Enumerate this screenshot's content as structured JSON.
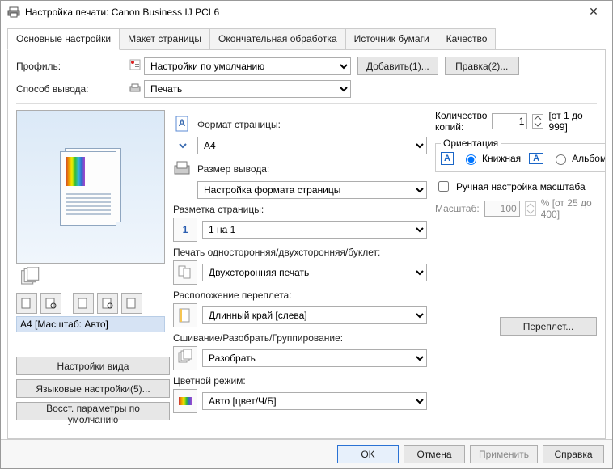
{
  "window": {
    "title": "Настройка печати: Canon Business IJ PCL6",
    "close_icon": "✕"
  },
  "tabs": [
    "Основные настройки",
    "Макет страницы",
    "Окончательная обработка",
    "Источник бумаги",
    "Качество"
  ],
  "profile": {
    "label": "Профиль:",
    "value": "Настройки по умолчанию",
    "add_btn": "Добавить(1)...",
    "edit_btn": "Правка(2)..."
  },
  "output_method": {
    "label": "Способ вывода:",
    "value": "Печать"
  },
  "preview": {
    "caption": "A4 [Масштаб: Авто]"
  },
  "left_buttons": {
    "view_settings": "Настройки вида",
    "lang_settings": "Языковые настройки(5)...",
    "restore_defaults": "Восст. параметры по умолчанию"
  },
  "page_size": {
    "label": "Формат страницы:",
    "value": "A4"
  },
  "output_size": {
    "label": "Размер вывода:",
    "value": "Настройка формата страницы"
  },
  "page_layout": {
    "label": "Разметка страницы:",
    "value": "1 на 1"
  },
  "print_mode": {
    "label": "Печать односторонняя/двухсторонняя/буклет:",
    "value": "Двухсторонняя печать"
  },
  "binding": {
    "label": "Расположение переплета:",
    "value": "Длинный край [слева]",
    "btn": "Переплет..."
  },
  "finishing": {
    "label": "Сшивание/Разобрать/Группирование:",
    "value": "Разобрать"
  },
  "color_mode": {
    "label": "Цветной режим:",
    "value": "Авто [цвет/Ч/Б]"
  },
  "copies": {
    "label": "Количество копий:",
    "value": "1",
    "range_hint": "[от 1 до 999]"
  },
  "orientation": {
    "legend": "Ориентация",
    "portrait": "Книжная",
    "landscape": "Альбомная"
  },
  "manual_scale": {
    "label": "Ручная настройка масштаба"
  },
  "scale": {
    "label": "Масштаб:",
    "value": "100",
    "range_hint": "% [от 25 до 400]"
  },
  "footer": {
    "ok": "OK",
    "cancel": "Отмена",
    "apply": "Применить",
    "help": "Справка"
  }
}
